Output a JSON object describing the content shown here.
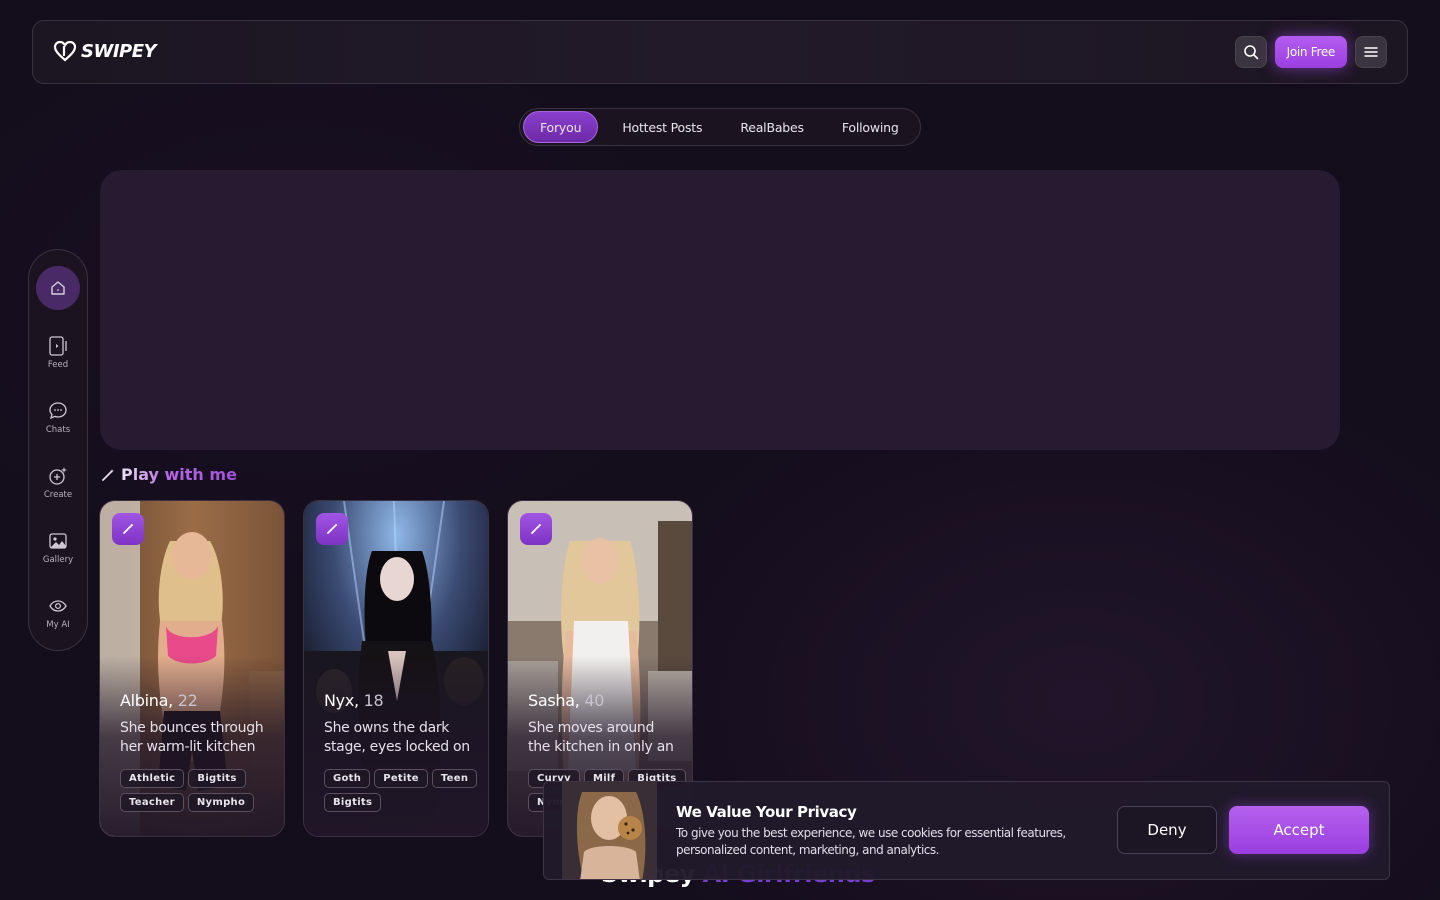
{
  "header": {
    "logo_text": "SWIPEY",
    "join_label": "Join Free"
  },
  "tabs": [
    {
      "label": "Foryou",
      "active": true
    },
    {
      "label": "Hottest Posts",
      "active": false
    },
    {
      "label": "RealBabes",
      "active": false
    },
    {
      "label": "Following",
      "active": false
    }
  ],
  "sidebar": {
    "items": [
      {
        "label": "Feed",
        "icon": "feed-icon"
      },
      {
        "label": "Chats",
        "icon": "chat-icon"
      },
      {
        "label": "Create",
        "icon": "create-icon"
      },
      {
        "label": "Gallery",
        "icon": "gallery-icon"
      },
      {
        "label": "My AI",
        "icon": "my-ai-icon"
      }
    ]
  },
  "section": {
    "title": "Play with me"
  },
  "cards": [
    {
      "name": "Albina,",
      "age": "22",
      "desc": "She bounces through her warm-lit kitchen",
      "tags": [
        "Athletic",
        "Bigtits",
        "Teacher",
        "Nympho"
      ]
    },
    {
      "name": "Nyx,",
      "age": "18",
      "desc": "She owns the dark stage, eyes locked on you",
      "tags": [
        "Goth",
        "Petite",
        "Teen",
        "Bigtits"
      ]
    },
    {
      "name": "Sasha,",
      "age": "40",
      "desc": "She moves around the kitchen in only an apron",
      "tags": [
        "Curvy",
        "Milf",
        "Bigtits",
        "Nympho"
      ]
    }
  ],
  "bottom": {
    "title": "Swipey",
    "accent": "AI Girlfriends"
  },
  "cookie": {
    "title": "We Value Your Privacy",
    "desc": "To give you the best experience, we use cookies for essential features, personalized content, marketing, and analytics.",
    "deny_label": "Deny",
    "accept_label": "Accept"
  },
  "colors": {
    "accent": "#9b3fe0",
    "background": "#140d1c"
  }
}
